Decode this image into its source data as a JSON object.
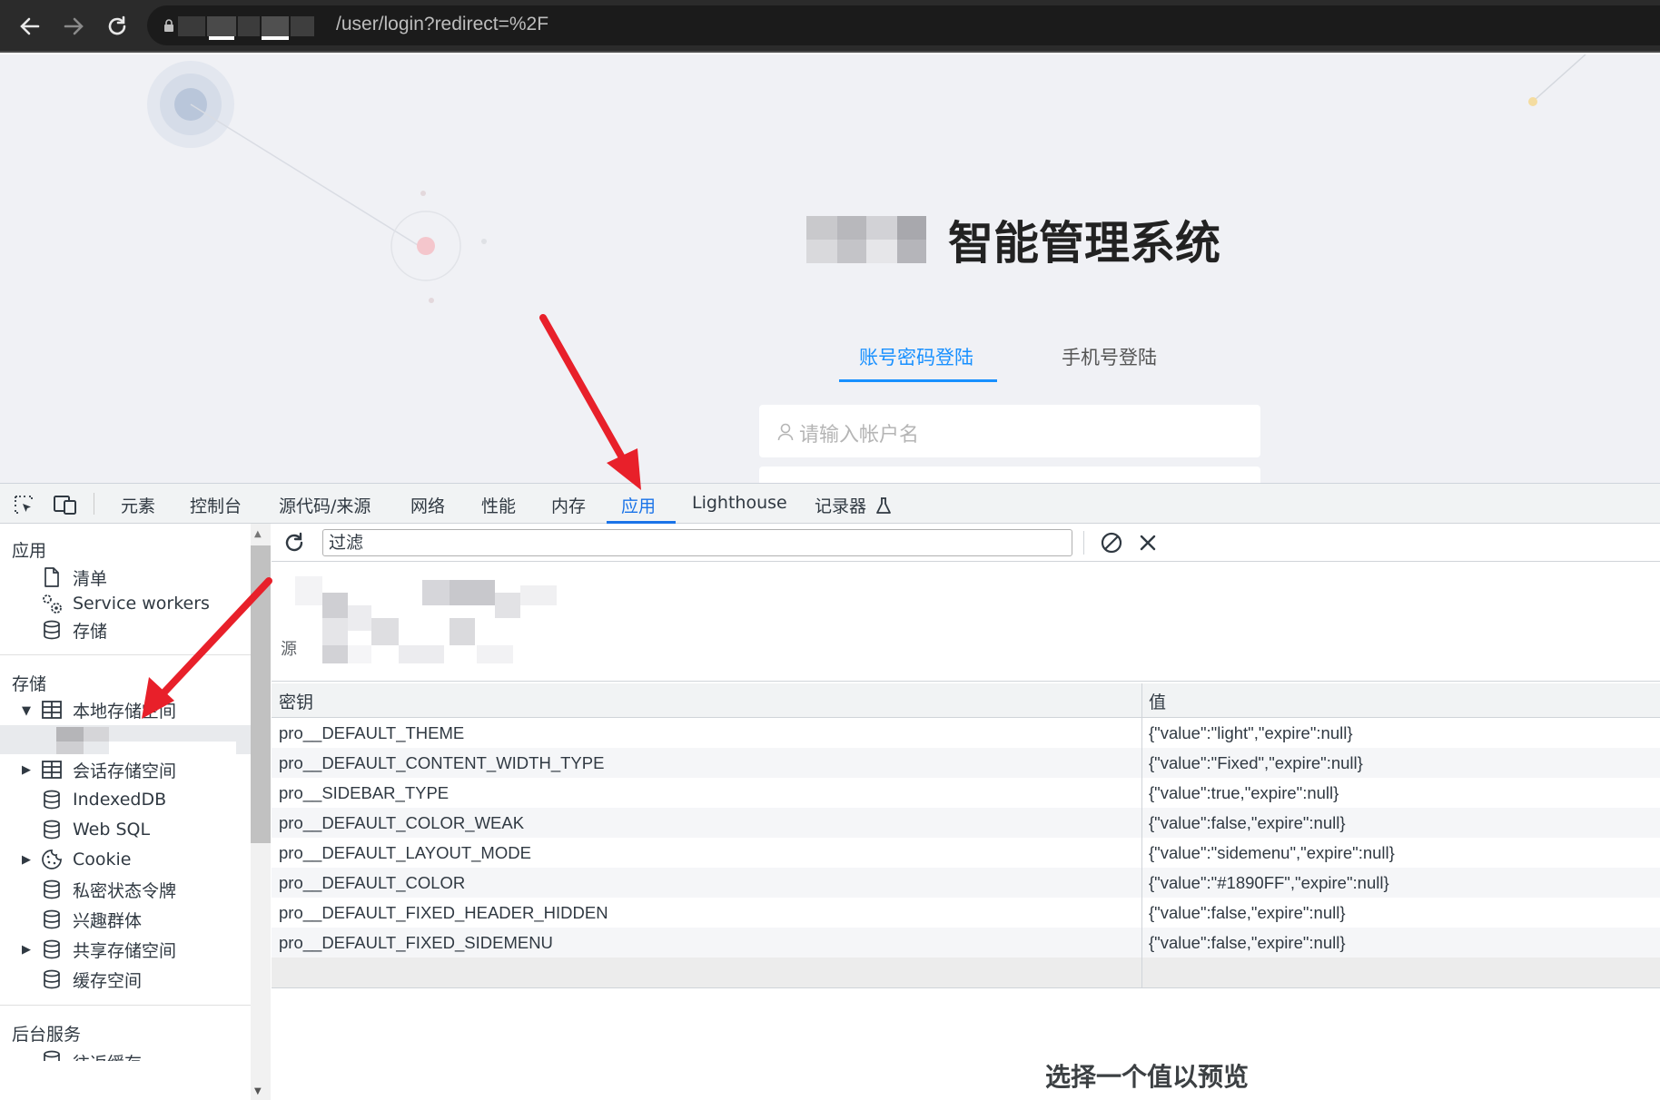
{
  "browser": {
    "url_visible": "/user/login?redirect=%2F"
  },
  "login_page": {
    "title": "智能管理系统",
    "tabs": [
      "账号密码登陆",
      "手机号登陆"
    ],
    "username_placeholder": "请输入帐户名",
    "accent_color": "#1890ff"
  },
  "devtools": {
    "tabs": [
      "元素",
      "控制台",
      "源代码/来源",
      "网络",
      "性能",
      "内存",
      "应用",
      "Lighthouse",
      "记录器"
    ],
    "active_tab": "应用",
    "sidebar": {
      "app_header": "应用",
      "app_items": [
        "清单",
        "Service workers",
        "存储"
      ],
      "storage_header": "存储",
      "storage_items": [
        "本地存储空间",
        "会话存储空间",
        "IndexedDB",
        "Web SQL",
        "Cookie",
        "私密状态令牌",
        "兴趣群体",
        "共享存储空间",
        "缓存空间"
      ],
      "backend_header": "后台服务",
      "backend_partial": "往返缓存"
    },
    "filter_placeholder": "过滤",
    "origin_label": "源",
    "table": {
      "headers": [
        "密钥",
        "值"
      ],
      "rows": [
        [
          "pro__DEFAULT_THEME",
          "{\"value\":\"light\",\"expire\":null}"
        ],
        [
          "pro__DEFAULT_CONTENT_WIDTH_TYPE",
          "{\"value\":\"Fixed\",\"expire\":null}"
        ],
        [
          "pro__SIDEBAR_TYPE",
          "{\"value\":true,\"expire\":null}"
        ],
        [
          "pro__DEFAULT_COLOR_WEAK",
          "{\"value\":false,\"expire\":null}"
        ],
        [
          "pro__DEFAULT_LAYOUT_MODE",
          "{\"value\":\"sidemenu\",\"expire\":null}"
        ],
        [
          "pro__DEFAULT_COLOR",
          "{\"value\":\"#1890FF\",\"expire\":null}"
        ],
        [
          "pro__DEFAULT_FIXED_HEADER_HIDDEN",
          "{\"value\":false,\"expire\":null}"
        ],
        [
          "pro__DEFAULT_FIXED_SIDEMENU",
          "{\"value\":false,\"expire\":null}"
        ]
      ]
    },
    "preview_text": "选择一个值以预览"
  },
  "annotation_color": "#e8202a"
}
